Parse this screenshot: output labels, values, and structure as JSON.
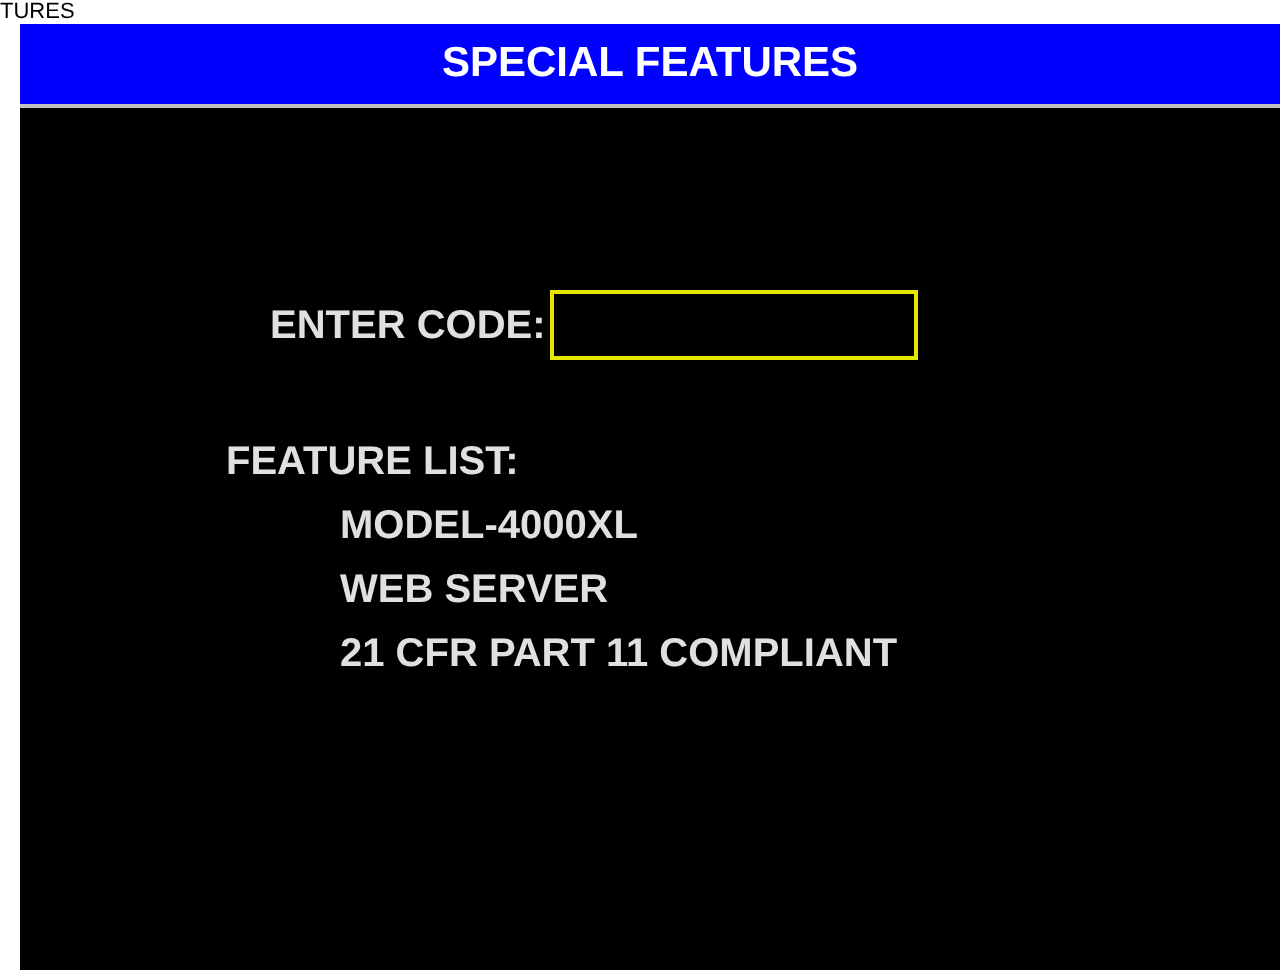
{
  "background_text": "TURES",
  "window": {
    "title": "SPECIAL FEATURES"
  },
  "code_field": {
    "label": "ENTER CODE:"
  },
  "feature_list": {
    "heading": "FEATURE LIST:",
    "items": [
      "MODEL-4000XL",
      "WEB SERVER",
      "21 CFR PART 11 COMPLIANT"
    ]
  }
}
